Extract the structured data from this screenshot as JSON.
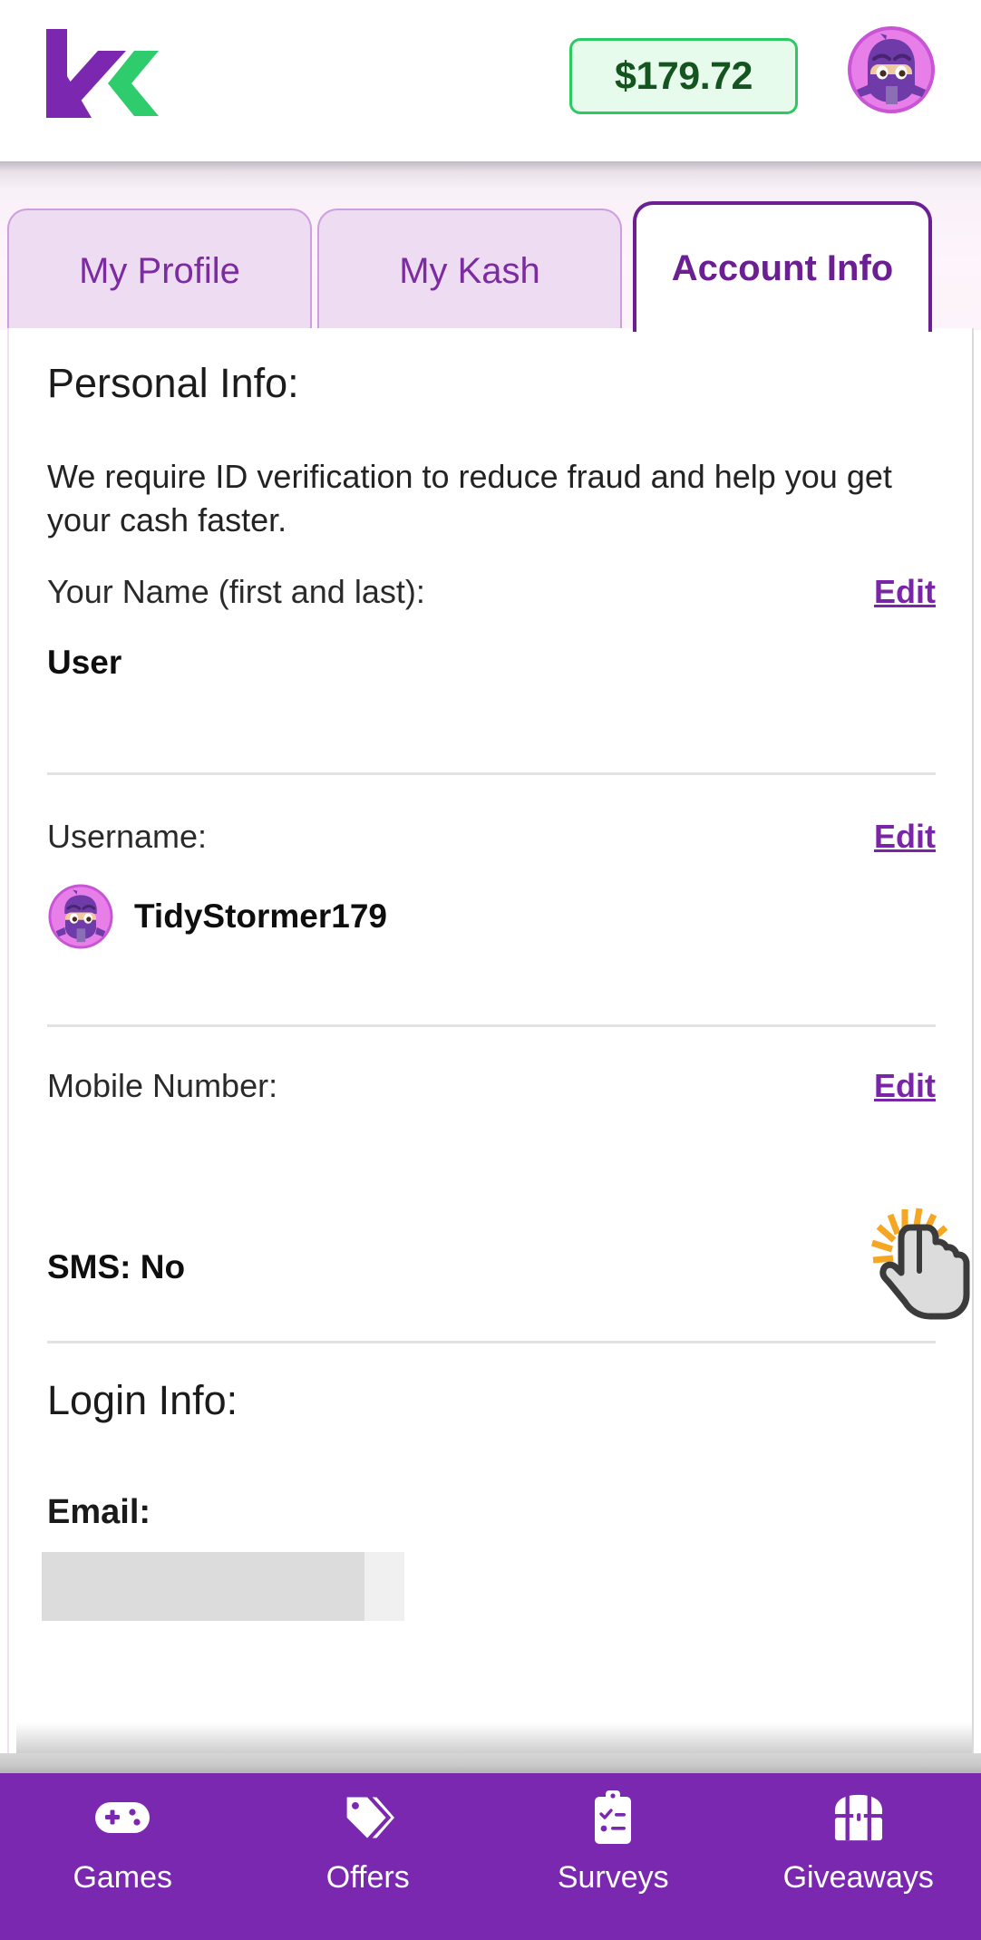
{
  "header": {
    "logo_name": "kashkick-logo",
    "balance": "$179.72",
    "avatar_name": "ninja-avatar"
  },
  "tabs": [
    {
      "label": "My Profile",
      "active": false
    },
    {
      "label": "My Kash",
      "active": false
    },
    {
      "label": "Account Info",
      "active": true
    }
  ],
  "content": {
    "personal_title": "Personal Info:",
    "description": "We require ID verification to reduce fraud and help you get your cash faster.",
    "name_label": "Your Name (first and last):",
    "name_edit": "Edit",
    "name_value": "User",
    "username_label": "Username:",
    "username_edit": "Edit",
    "username_value": "TidyStormer179",
    "mobile_label": "Mobile Number:",
    "mobile_edit": "Edit",
    "sms_value": "SMS: No",
    "login_title": "Login Info:",
    "email_label": "Email:"
  },
  "bottom_nav": [
    {
      "label": "Games",
      "icon": "gamepad-icon"
    },
    {
      "label": "Offers",
      "icon": "tag-icon"
    },
    {
      "label": "Surveys",
      "icon": "clipboard-checklist-icon"
    },
    {
      "label": "Giveaways",
      "icon": "treasure-chest-icon"
    }
  ],
  "cursor": {
    "icon": "pointing-hand-click-cursor"
  },
  "colors": {
    "brand_purple": "#7a28b0",
    "logo_purple": "#7b27b0",
    "logo_green": "#2fcc6e",
    "balance_green_text": "#14541f",
    "balance_green_bg": "#e7fbec",
    "balance_green_border": "#2fc963",
    "tab_active_border": "#6b1f93",
    "tab_inactive_bg": "#eedcf3",
    "edit_link": "#7a25a8",
    "cursor_orange": "#f5a623"
  }
}
